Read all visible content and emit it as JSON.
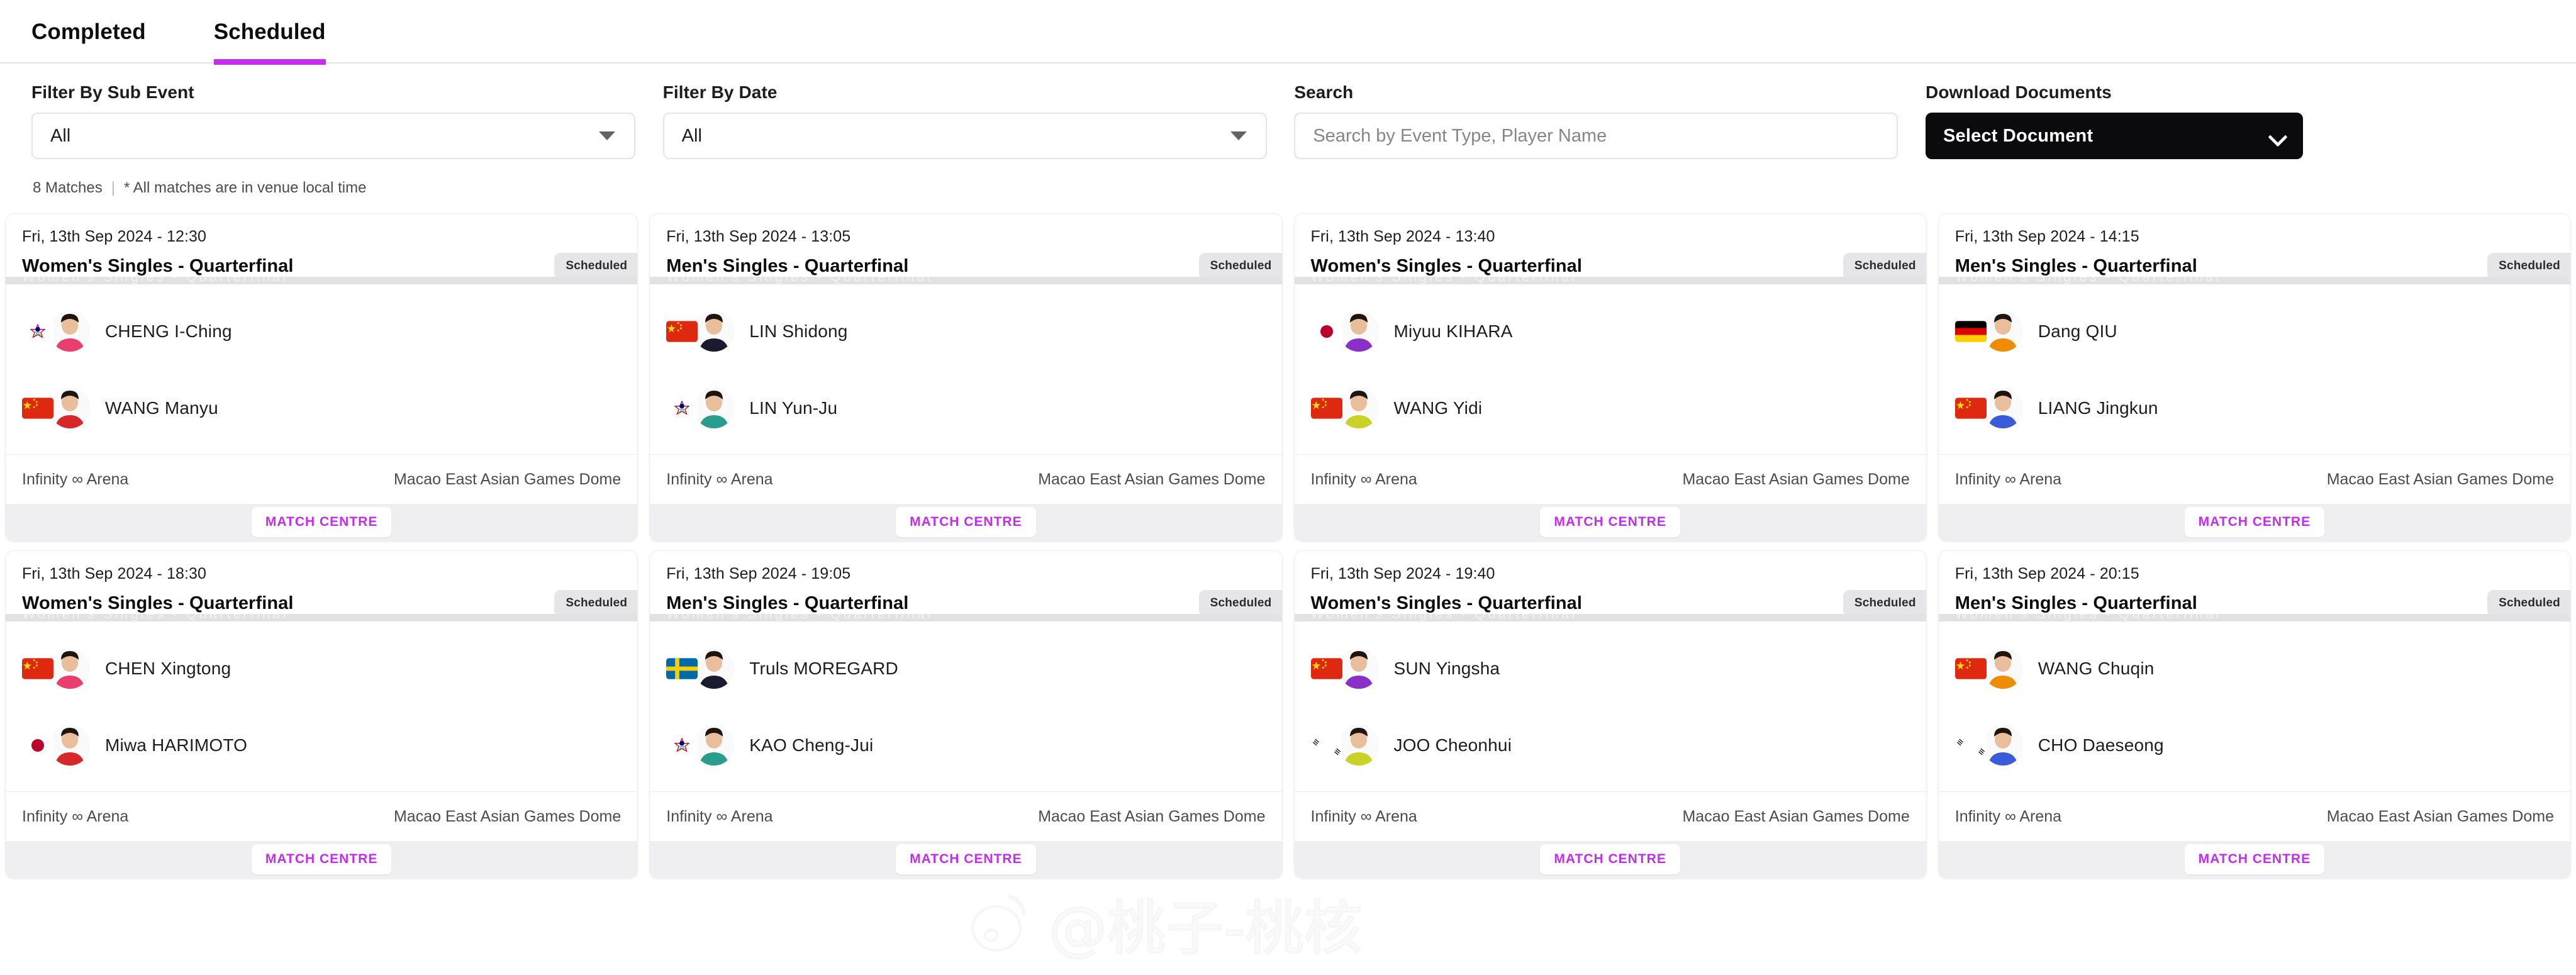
{
  "tabs": [
    {
      "label": "Completed",
      "active": false
    },
    {
      "label": "Scheduled",
      "active": true
    }
  ],
  "filters": {
    "sub_event": {
      "label": "Filter By Sub Event",
      "value": "All"
    },
    "date": {
      "label": "Filter By Date",
      "value": "All"
    },
    "search": {
      "label": "Search",
      "placeholder": "Search by Event Type, Player Name",
      "value": ""
    },
    "download": {
      "label": "Download Documents",
      "button_label": "Select Document"
    }
  },
  "meta": {
    "match_count": "8 Matches",
    "divider": "|",
    "note": "* All matches are in venue local time"
  },
  "accent_color": "#c62bf0",
  "ghost_text": "Women's Singles - Quarterfinal",
  "matches": [
    {
      "date": "Fri, 13th Sep 2024 - 12:30",
      "title": "Women's Singles - Quarterfinal",
      "status": "Scheduled",
      "players": [
        {
          "name": "CHENG I-Ching",
          "flag": "chinese-taipei"
        },
        {
          "name": "WANG Manyu",
          "flag": "china"
        }
      ],
      "arena": "Infinity ∞ Arena",
      "venue": "Macao East Asian Games Dome",
      "cta": "MATCH CENTRE"
    },
    {
      "date": "Fri, 13th Sep 2024 - 13:05",
      "title": "Men's Singles - Quarterfinal",
      "status": "Scheduled",
      "players": [
        {
          "name": "LIN Shidong",
          "flag": "china"
        },
        {
          "name": "LIN Yun-Ju",
          "flag": "chinese-taipei"
        }
      ],
      "arena": "Infinity ∞ Arena",
      "venue": "Macao East Asian Games Dome",
      "cta": "MATCH CENTRE"
    },
    {
      "date": "Fri, 13th Sep 2024 - 13:40",
      "title": "Women's Singles - Quarterfinal",
      "status": "Scheduled",
      "players": [
        {
          "name": "Miyuu KIHARA",
          "flag": "japan"
        },
        {
          "name": "WANG Yidi",
          "flag": "china"
        }
      ],
      "arena": "Infinity ∞ Arena",
      "venue": "Macao East Asian Games Dome",
      "cta": "MATCH CENTRE"
    },
    {
      "date": "Fri, 13th Sep 2024 - 14:15",
      "title": "Men's Singles - Quarterfinal",
      "status": "Scheduled",
      "players": [
        {
          "name": "Dang QIU",
          "flag": "germany"
        },
        {
          "name": "LIANG Jingkun",
          "flag": "china"
        }
      ],
      "arena": "Infinity ∞ Arena",
      "venue": "Macao East Asian Games Dome",
      "cta": "MATCH CENTRE"
    },
    {
      "date": "Fri, 13th Sep 2024 - 18:30",
      "title": "Women's Singles - Quarterfinal",
      "status": "Scheduled",
      "players": [
        {
          "name": "CHEN Xingtong",
          "flag": "china"
        },
        {
          "name": "Miwa HARIMOTO",
          "flag": "japan"
        }
      ],
      "arena": "Infinity ∞ Arena",
      "venue": "Macao East Asian Games Dome",
      "cta": "MATCH CENTRE"
    },
    {
      "date": "Fri, 13th Sep 2024 - 19:05",
      "title": "Men's Singles - Quarterfinal",
      "status": "Scheduled",
      "players": [
        {
          "name": "Truls MOREGARD",
          "flag": "sweden"
        },
        {
          "name": "KAO Cheng-Jui",
          "flag": "chinese-taipei"
        }
      ],
      "arena": "Infinity ∞ Arena",
      "venue": "Macao East Asian Games Dome",
      "cta": "MATCH CENTRE"
    },
    {
      "date": "Fri, 13th Sep 2024 - 19:40",
      "title": "Women's Singles - Quarterfinal",
      "status": "Scheduled",
      "players": [
        {
          "name": "SUN Yingsha",
          "flag": "china"
        },
        {
          "name": "JOO Cheonhui",
          "flag": "south-korea"
        }
      ],
      "arena": "Infinity ∞ Arena",
      "venue": "Macao East Asian Games Dome",
      "cta": "MATCH CENTRE"
    },
    {
      "date": "Fri, 13th Sep 2024 - 20:15",
      "title": "Men's Singles - Quarterfinal",
      "status": "Scheduled",
      "players": [
        {
          "name": "WANG Chuqin",
          "flag": "china"
        },
        {
          "name": "CHO Daeseong",
          "flag": "south-korea"
        }
      ],
      "arena": "Infinity ∞ Arena",
      "venue": "Macao East Asian Games Dome",
      "cta": "MATCH CENTRE"
    }
  ],
  "watermark": {
    "handle": "@桃子-桃核"
  }
}
